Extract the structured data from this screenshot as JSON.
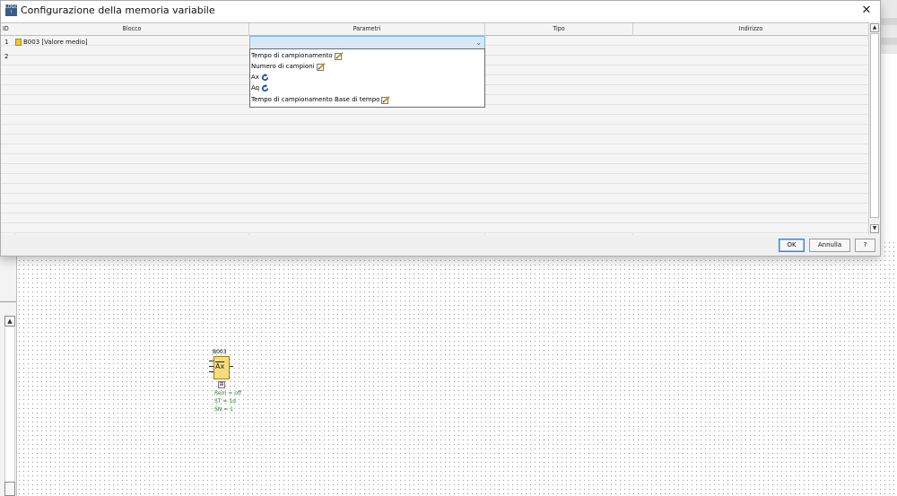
{
  "dialog": {
    "app_icon": "logo-icon",
    "title": "Configurazione della memoria variabile",
    "close_glyph": "✕",
    "columns": [
      "ID",
      "Blocco",
      "Parametri",
      "Tipo",
      "Indirizzo"
    ],
    "rows": [
      {
        "id": "1",
        "block": "B003 [Valore medio]"
      },
      {
        "id": "2",
        "block": ""
      }
    ],
    "dropdown": {
      "selected": "",
      "chevron_glyph": "⌄",
      "options": [
        {
          "label": "Tempo di campionamento",
          "icon": "edit-icon"
        },
        {
          "label": "Numero di campioni",
          "icon": "edit-icon"
        },
        {
          "label": "Ax",
          "icon": "refresh-icon"
        },
        {
          "label": "Aq",
          "icon": "refresh-icon"
        },
        {
          "label": "Tempo di campionamento Base di tempo",
          "icon": "edit-icon"
        }
      ]
    },
    "buttons": {
      "ok": "OK",
      "cancel": "Annulla",
      "help": "?"
    }
  },
  "diagram": {
    "block_name": "B003",
    "block_symbol": "Ax",
    "expand_glyph": "⊞",
    "params": [
      "Rem = off",
      "ST = 1d",
      "SN = 1"
    ]
  },
  "colors": {
    "accent": "#3c7fd1",
    "block_fill": "#f6dc7c",
    "param_text": "#2e7d32",
    "selection": "#d7e9f7"
  }
}
